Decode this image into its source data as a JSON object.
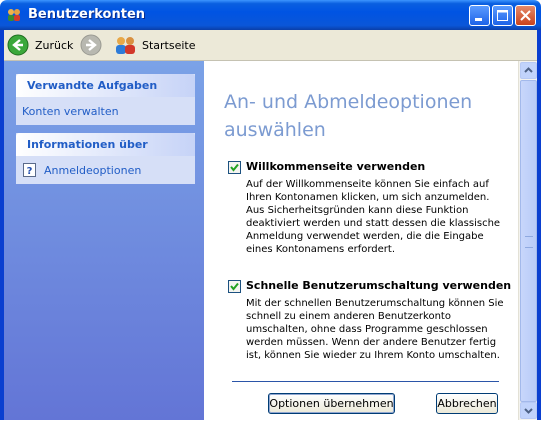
{
  "window": {
    "title": "Benutzerkonten"
  },
  "toolbar": {
    "back_label": "Zurück",
    "home_label": "Startseite"
  },
  "sidebar": {
    "related": {
      "title": "Verwandte Aufgaben",
      "items": [
        "Konten verwalten"
      ]
    },
    "info": {
      "title": "Informationen über",
      "items": [
        "Anmeldeoptionen"
      ]
    }
  },
  "main": {
    "heading": "An- und Abmeldeoptionen auswählen",
    "options": [
      {
        "label": "Willkommenseite verwenden",
        "checked": true,
        "description": "Auf der Willkommenseite können Sie einfach auf Ihren Kontonamen klicken, um sich anzumelden. Aus Sicherheitsgründen kann diese Funktion deaktiviert werden und statt dessen die klassische Anmeldung verwendet werden, die die Eingabe eines Kontonamens erfordert."
      },
      {
        "label": "Schnelle Benutzerumschaltung verwenden",
        "checked": true,
        "description": "Mit der schnellen Benutzerumschaltung können Sie schnell zu einem anderen Benutzerkonto umschalten, ohne dass Programme geschlossen werden müssen. Wenn der andere Benutzer fertig ist, können Sie wieder zu Ihrem Konto umschalten."
      }
    ],
    "apply_button": "Optionen übernehmen",
    "cancel_button": "Abbrechen"
  }
}
